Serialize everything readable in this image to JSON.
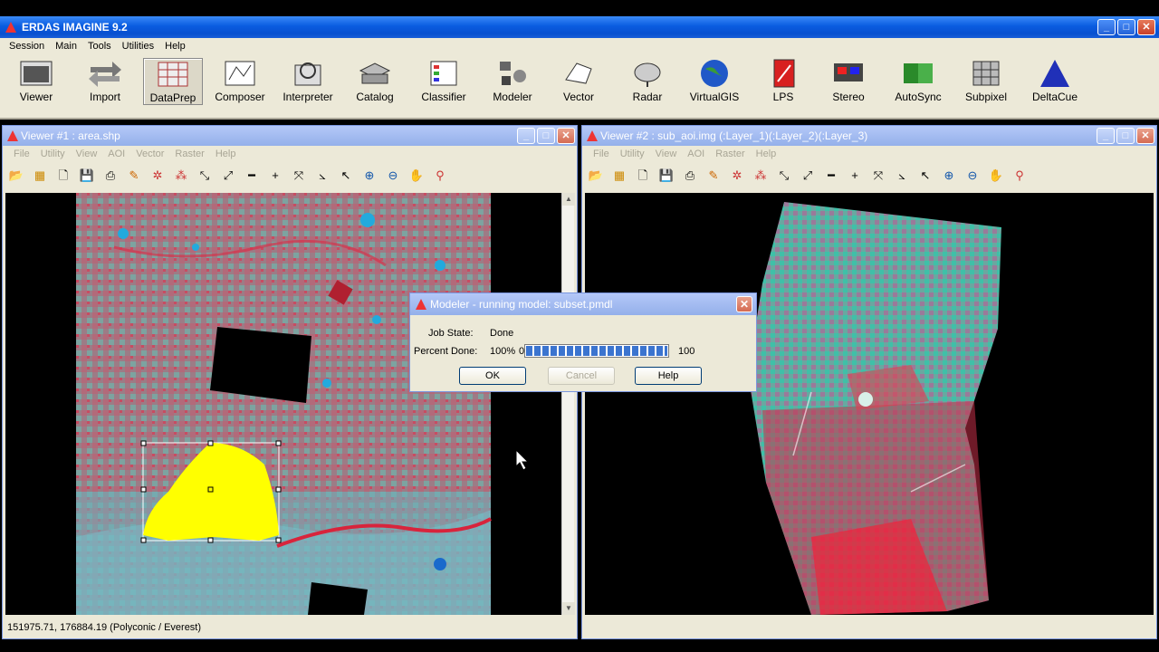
{
  "app": {
    "title": "ERDAS IMAGINE 9.2",
    "menu": [
      "Session",
      "Main",
      "Tools",
      "Utilities",
      "Help"
    ]
  },
  "toolbar": {
    "tools": [
      {
        "label": "Viewer",
        "icon": "viewer-icon"
      },
      {
        "label": "Import",
        "icon": "import-icon"
      },
      {
        "label": "DataPrep",
        "icon": "dataprep-icon",
        "selected": true
      },
      {
        "label": "Composer",
        "icon": "composer-icon"
      },
      {
        "label": "Interpreter",
        "icon": "interpreter-icon"
      },
      {
        "label": "Catalog",
        "icon": "catalog-icon"
      },
      {
        "label": "Classifier",
        "icon": "classifier-icon"
      },
      {
        "label": "Modeler",
        "icon": "modeler-icon"
      },
      {
        "label": "Vector",
        "icon": "vector-icon"
      },
      {
        "label": "Radar",
        "icon": "radar-icon"
      },
      {
        "label": "VirtualGIS",
        "icon": "globe-icon"
      },
      {
        "label": "LPS",
        "icon": "lps-icon"
      },
      {
        "label": "Stereo",
        "icon": "stereo-icon"
      },
      {
        "label": "AutoSync",
        "icon": "autosync-icon"
      },
      {
        "label": "Subpixel",
        "icon": "subpixel-icon"
      },
      {
        "label": "DeltaCue",
        "icon": "deltacue-icon"
      }
    ]
  },
  "viewer1": {
    "title": "Viewer #1 : area.shp",
    "menu": [
      "File",
      "Utility",
      "View",
      "AOI",
      "Vector",
      "Raster",
      "Help"
    ],
    "status": "151975.71, 176884.19   (Polyconic / Everest)"
  },
  "viewer2": {
    "title": "Viewer #2 : sub_aoi.img (:Layer_1)(:Layer_2)(:Layer_3)",
    "menu": [
      "File",
      "Utility",
      "View",
      "AOI",
      "Raster",
      "Help"
    ]
  },
  "dialog": {
    "title": "Modeler - running model: subset.pmdl",
    "job_state_label": "Job State:",
    "job_state_value": "Done",
    "percent_label": "Percent Done:",
    "percent_value": "100%",
    "progress_min": "0",
    "progress_max": "100",
    "progress_fraction": 1.0,
    "ok_label": "OK",
    "cancel_label": "Cancel",
    "help_label": "Help"
  },
  "colors": {
    "title_active": "#0a5ce0",
    "title_inactive": "#94b0ea",
    "face": "#ece9d8",
    "aoi_fill": "#ffff00"
  }
}
